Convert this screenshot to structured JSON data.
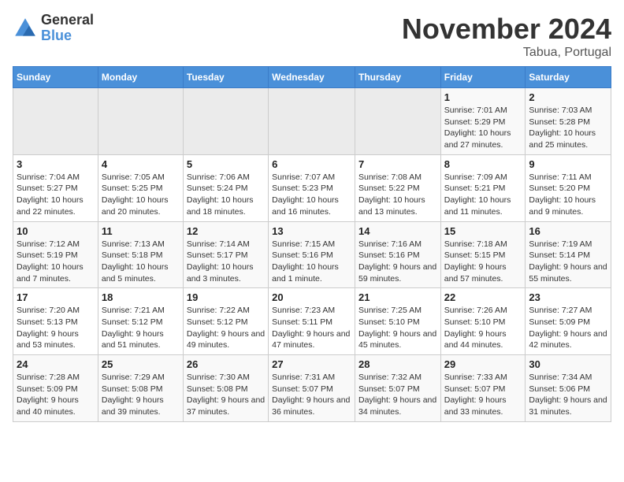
{
  "header": {
    "logo_general": "General",
    "logo_blue": "Blue",
    "title": "November 2024",
    "subtitle": "Tabua, Portugal"
  },
  "days_of_week": [
    "Sunday",
    "Monday",
    "Tuesday",
    "Wednesday",
    "Thursday",
    "Friday",
    "Saturday"
  ],
  "weeks": [
    [
      {
        "day": "",
        "info": ""
      },
      {
        "day": "",
        "info": ""
      },
      {
        "day": "",
        "info": ""
      },
      {
        "day": "",
        "info": ""
      },
      {
        "day": "",
        "info": ""
      },
      {
        "day": "1",
        "info": "Sunrise: 7:01 AM\nSunset: 5:29 PM\nDaylight: 10 hours and 27 minutes."
      },
      {
        "day": "2",
        "info": "Sunrise: 7:03 AM\nSunset: 5:28 PM\nDaylight: 10 hours and 25 minutes."
      }
    ],
    [
      {
        "day": "3",
        "info": "Sunrise: 7:04 AM\nSunset: 5:27 PM\nDaylight: 10 hours and 22 minutes."
      },
      {
        "day": "4",
        "info": "Sunrise: 7:05 AM\nSunset: 5:25 PM\nDaylight: 10 hours and 20 minutes."
      },
      {
        "day": "5",
        "info": "Sunrise: 7:06 AM\nSunset: 5:24 PM\nDaylight: 10 hours and 18 minutes."
      },
      {
        "day": "6",
        "info": "Sunrise: 7:07 AM\nSunset: 5:23 PM\nDaylight: 10 hours and 16 minutes."
      },
      {
        "day": "7",
        "info": "Sunrise: 7:08 AM\nSunset: 5:22 PM\nDaylight: 10 hours and 13 minutes."
      },
      {
        "day": "8",
        "info": "Sunrise: 7:09 AM\nSunset: 5:21 PM\nDaylight: 10 hours and 11 minutes."
      },
      {
        "day": "9",
        "info": "Sunrise: 7:11 AM\nSunset: 5:20 PM\nDaylight: 10 hours and 9 minutes."
      }
    ],
    [
      {
        "day": "10",
        "info": "Sunrise: 7:12 AM\nSunset: 5:19 PM\nDaylight: 10 hours and 7 minutes."
      },
      {
        "day": "11",
        "info": "Sunrise: 7:13 AM\nSunset: 5:18 PM\nDaylight: 10 hours and 5 minutes."
      },
      {
        "day": "12",
        "info": "Sunrise: 7:14 AM\nSunset: 5:17 PM\nDaylight: 10 hours and 3 minutes."
      },
      {
        "day": "13",
        "info": "Sunrise: 7:15 AM\nSunset: 5:16 PM\nDaylight: 10 hours and 1 minute."
      },
      {
        "day": "14",
        "info": "Sunrise: 7:16 AM\nSunset: 5:16 PM\nDaylight: 9 hours and 59 minutes."
      },
      {
        "day": "15",
        "info": "Sunrise: 7:18 AM\nSunset: 5:15 PM\nDaylight: 9 hours and 57 minutes."
      },
      {
        "day": "16",
        "info": "Sunrise: 7:19 AM\nSunset: 5:14 PM\nDaylight: 9 hours and 55 minutes."
      }
    ],
    [
      {
        "day": "17",
        "info": "Sunrise: 7:20 AM\nSunset: 5:13 PM\nDaylight: 9 hours and 53 minutes."
      },
      {
        "day": "18",
        "info": "Sunrise: 7:21 AM\nSunset: 5:12 PM\nDaylight: 9 hours and 51 minutes."
      },
      {
        "day": "19",
        "info": "Sunrise: 7:22 AM\nSunset: 5:12 PM\nDaylight: 9 hours and 49 minutes."
      },
      {
        "day": "20",
        "info": "Sunrise: 7:23 AM\nSunset: 5:11 PM\nDaylight: 9 hours and 47 minutes."
      },
      {
        "day": "21",
        "info": "Sunrise: 7:25 AM\nSunset: 5:10 PM\nDaylight: 9 hours and 45 minutes."
      },
      {
        "day": "22",
        "info": "Sunrise: 7:26 AM\nSunset: 5:10 PM\nDaylight: 9 hours and 44 minutes."
      },
      {
        "day": "23",
        "info": "Sunrise: 7:27 AM\nSunset: 5:09 PM\nDaylight: 9 hours and 42 minutes."
      }
    ],
    [
      {
        "day": "24",
        "info": "Sunrise: 7:28 AM\nSunset: 5:09 PM\nDaylight: 9 hours and 40 minutes."
      },
      {
        "day": "25",
        "info": "Sunrise: 7:29 AM\nSunset: 5:08 PM\nDaylight: 9 hours and 39 minutes."
      },
      {
        "day": "26",
        "info": "Sunrise: 7:30 AM\nSunset: 5:08 PM\nDaylight: 9 hours and 37 minutes."
      },
      {
        "day": "27",
        "info": "Sunrise: 7:31 AM\nSunset: 5:07 PM\nDaylight: 9 hours and 36 minutes."
      },
      {
        "day": "28",
        "info": "Sunrise: 7:32 AM\nSunset: 5:07 PM\nDaylight: 9 hours and 34 minutes."
      },
      {
        "day": "29",
        "info": "Sunrise: 7:33 AM\nSunset: 5:07 PM\nDaylight: 9 hours and 33 minutes."
      },
      {
        "day": "30",
        "info": "Sunrise: 7:34 AM\nSunset: 5:06 PM\nDaylight: 9 hours and 31 minutes."
      }
    ]
  ]
}
